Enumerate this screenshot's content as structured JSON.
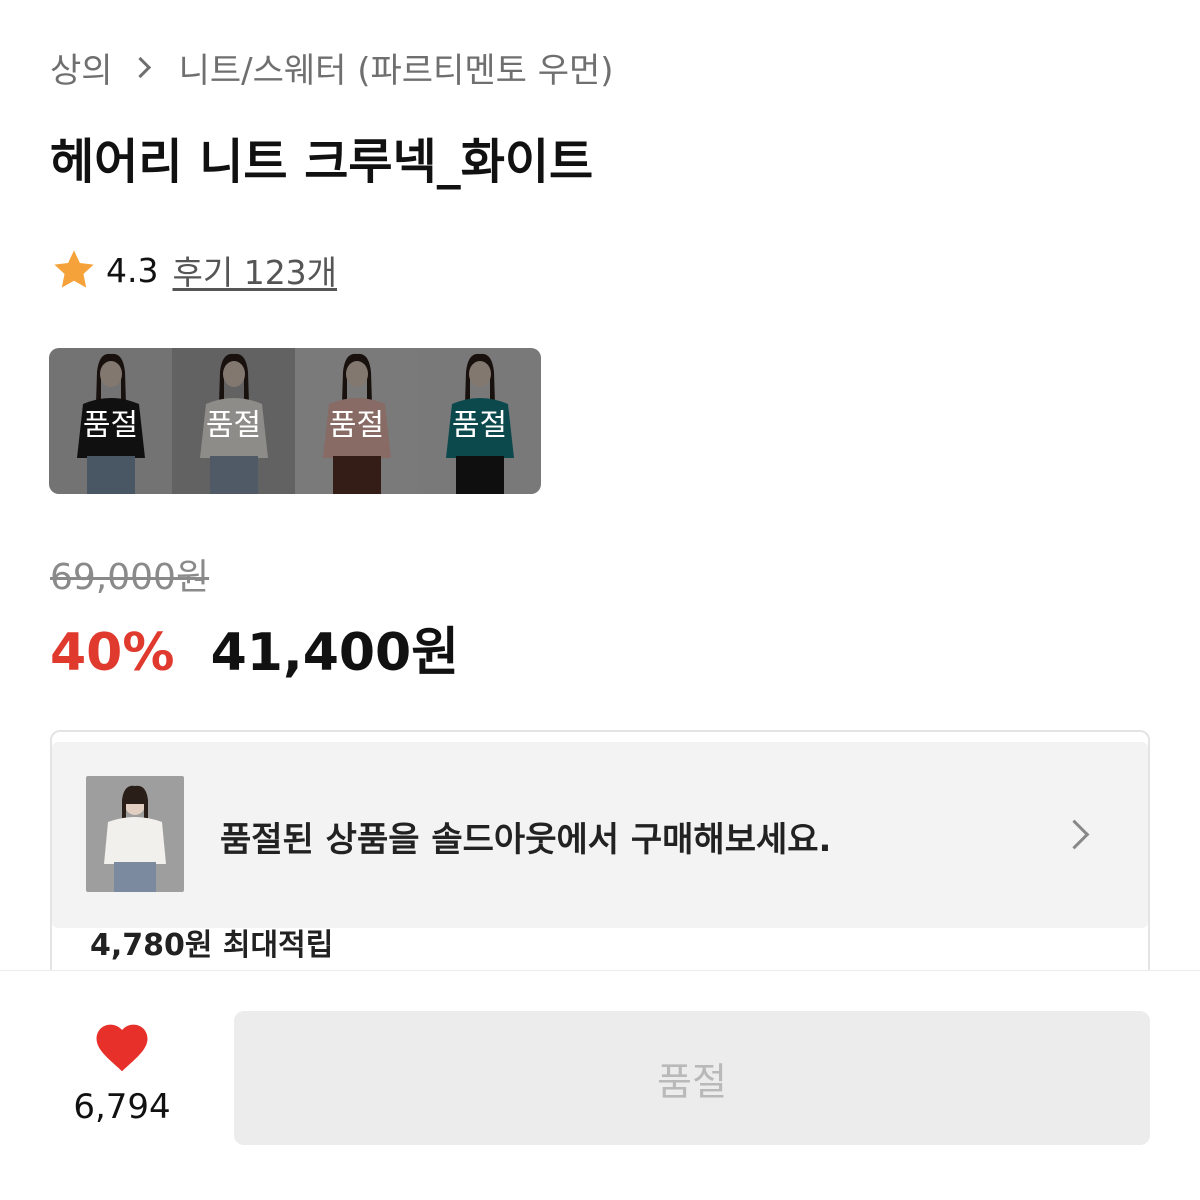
{
  "breadcrumb": {
    "category": "상의",
    "subcategory": "니트/스웨터 (파르티멘토 우먼)"
  },
  "product": {
    "title": "헤어리 니트 크루넥_화이트",
    "rating": "4.3",
    "reviews_label": "후기 123개"
  },
  "variants": [
    {
      "label": "품절",
      "top_color": "#1c1c1c",
      "bottom_color": "#7f95ad",
      "bg": "#c7c7c7"
    },
    {
      "label": "품절",
      "top_color": "#f4f1ea",
      "bottom_color": "#8a9bb0",
      "bg": "#a9a9a9"
    },
    {
      "label": "품절",
      "top_color": "#e8b8ac",
      "bottom_color": "#5a3328",
      "bg": "#d2d2d2"
    },
    {
      "label": "품절",
      "top_color": "#137f86",
      "bottom_color": "#1a1a1a",
      "bg": "#d0d0d0"
    }
  ],
  "pricing": {
    "original": "69,000원",
    "discount": "40%",
    "final": "41,400원"
  },
  "info_card": {
    "peek_text": "4,780원 최대적립"
  },
  "soldout_banner": {
    "message": "품절된 상품을 솔드아웃에서 구매해보세요."
  },
  "bottom_bar": {
    "like_count": "6,794",
    "buy_label": "품절"
  },
  "colors": {
    "accent_red": "#e03a2f",
    "heart": "#e8302a",
    "star": "#f5a23a"
  }
}
